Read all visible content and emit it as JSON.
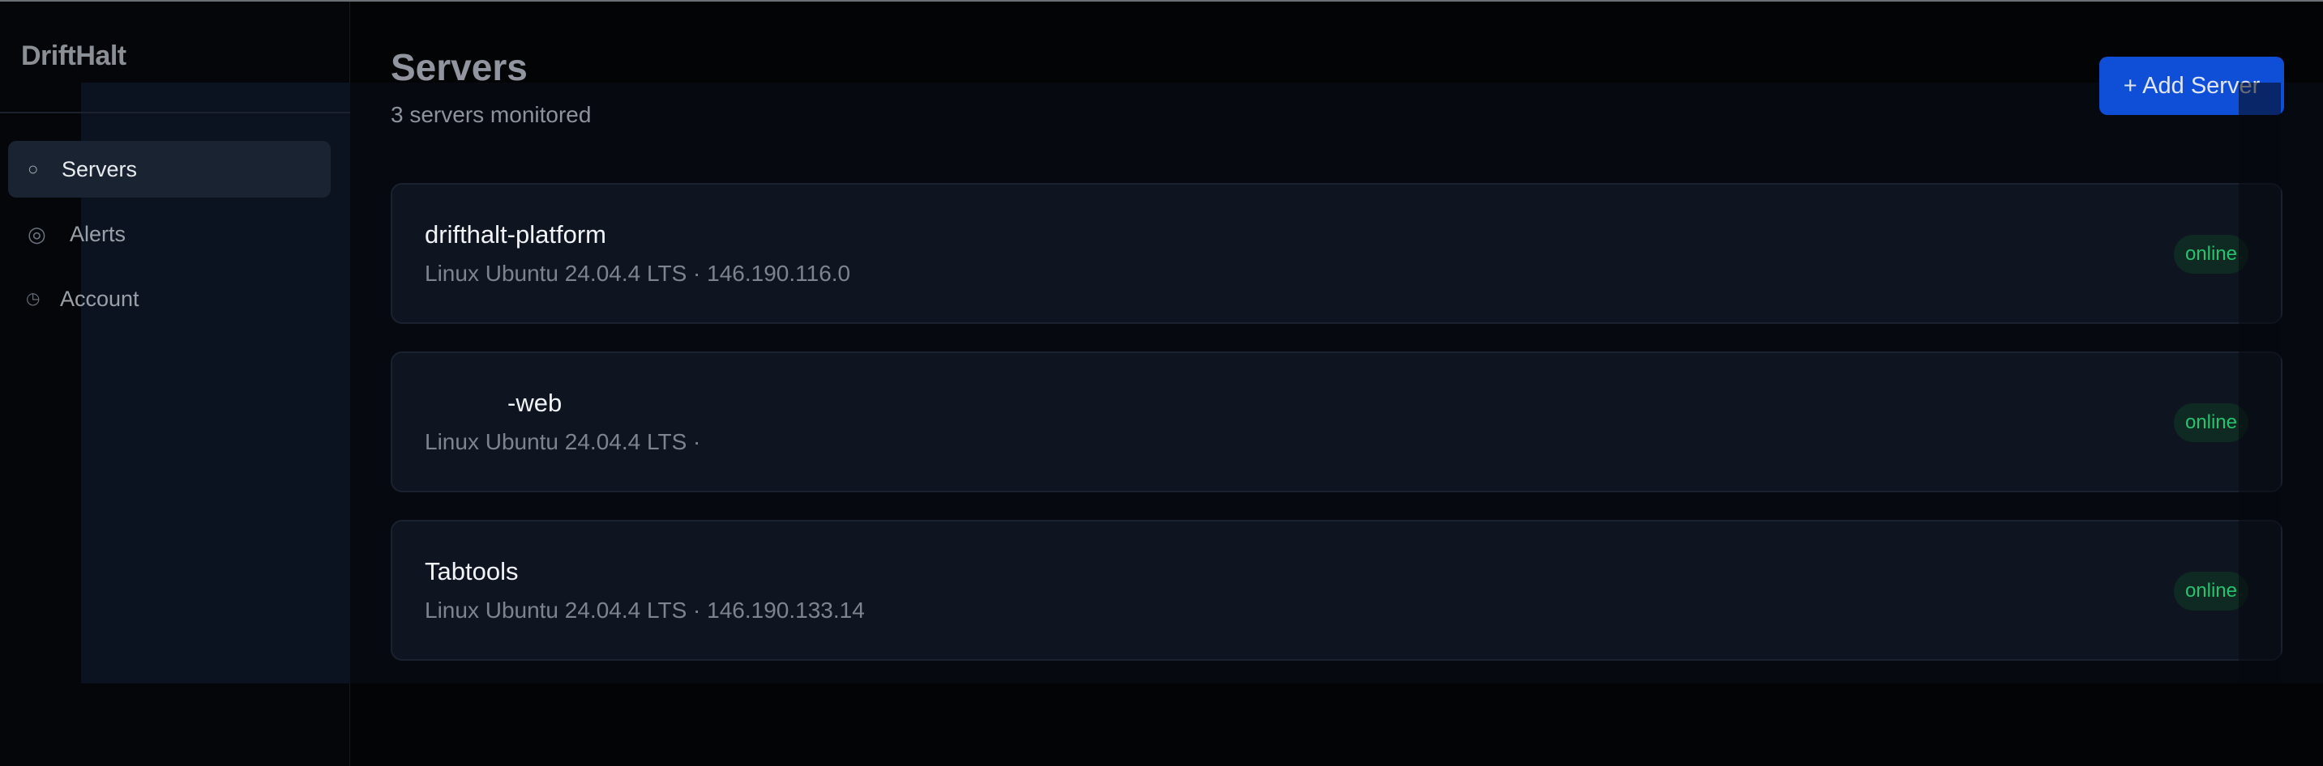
{
  "app": {
    "brand": "DriftHalt"
  },
  "sidebar": {
    "items": [
      {
        "label": "Servers",
        "icon": "server-icon",
        "glyph": "○",
        "active": true
      },
      {
        "label": "Alerts",
        "icon": "alert-icon",
        "glyph": "◎",
        "active": false
      },
      {
        "label": "Account",
        "icon": "account-icon",
        "glyph": "◷",
        "active": false
      }
    ]
  },
  "main": {
    "title": "Servers",
    "subtitle": "3 servers monitored",
    "add_button_label": "+ Add Server",
    "servers": [
      {
        "name": "drifthalt-platform",
        "meta": "Linux Ubuntu 24.04.4 LTS · 146.190.116.0",
        "status": "online"
      },
      {
        "name": "-web",
        "meta": "Linux Ubuntu 24.04.4 LTS ·",
        "status": "online"
      },
      {
        "name": "Tabtools",
        "meta": "Linux Ubuntu 24.04.4 LTS · 146.190.133.14",
        "status": "online"
      }
    ]
  },
  "colors": {
    "accent": "#0f4fd8",
    "status_online": "#27c26d",
    "background": "#030405",
    "card": "#0e1521"
  }
}
